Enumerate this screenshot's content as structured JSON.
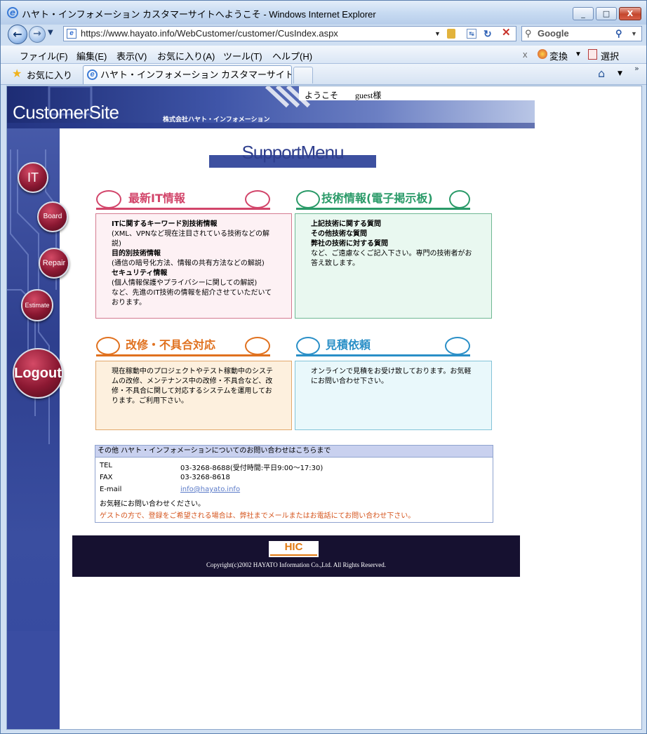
{
  "window": {
    "title": "ハヤト・インフォメーション カスタマーサイトへようこそ - Windows Internet Explorer",
    "minimize": "_",
    "maximize": "□",
    "close": "X"
  },
  "navigation": {
    "url": "https://www.hayato.info/WebCustomer/customer/CusIndex.aspx",
    "search_placeholder": "Google"
  },
  "menubar": {
    "items": [
      "ファイル(F)",
      "編集(E)",
      "表示(V)",
      "お気に入り(A)",
      "ツール(T)",
      "ヘルプ(H)"
    ],
    "close": "x",
    "convert": "変換",
    "select": "選択"
  },
  "favorites": {
    "label": "お気に入り",
    "active_tab": "ハヤト・インフォメーション カスタマーサイト..."
  },
  "header": {
    "logo": "CustomerSite",
    "company": "株式会社ハヤト・インフォメーション",
    "welcome": "ようこそ　　guest様"
  },
  "sidebar": {
    "items": [
      "IT",
      "Board",
      "Repair",
      "Estimate",
      "Logout"
    ]
  },
  "main": {
    "title": "SupportMenu",
    "sections": {
      "it": {
        "heading": "最新IT情報",
        "lines": [
          "ITに関するキーワード別技術情報",
          "(XML、VPNなど現在注目されている技術などの解説)",
          "目的別技術情報",
          "(通信の暗号化方法、情報の共有方法などの解説)",
          "セキュリティ情報",
          "(個人情報保護やプライバシーに関しての解説)",
          "など、先進のIT技術の情報を紹介させていただいております。"
        ]
      },
      "board": {
        "heading": "技術情報(電子掲示板)",
        "lines": [
          "上記技術に関する質問",
          "その他技術な質問",
          "弊社の技術に対する質問",
          "など、ご遠慮なくご記入下さい。専門の技術者がお答え致します。"
        ]
      },
      "repair": {
        "heading": "改修・不具合対応",
        "text": "現在稼動中のプロジェクトやテスト稼動中のシステムの改修、メンテナンス中の改修・不具合など、改修・不具合に関して対応するシステムを運用しております。ご利用下さい。"
      },
      "estimate": {
        "heading": "見積依頼",
        "text": "オンラインで見積をお受け致しております。お気軽にお問い合わせ下さい。"
      }
    },
    "contact": {
      "title": "その他 ハヤト・インフォメーションについてのお問い合わせはこちらまで",
      "tel_label": "TEL",
      "tel": "03-3268-8688(受付時間:平日9:00～17:30)",
      "fax_label": "FAX",
      "fax": "03-3268-8618",
      "email_label": "E-mail",
      "email": "info@hayato.info",
      "note": "お気軽にお問い合わせください。",
      "guest_note": "ゲストの方で、登録をご希望される場合は、弊社までメールまたはお電話にてお問い合わせ下さい。"
    }
  },
  "footer": {
    "logo": "HIC",
    "copyright": "Copyright(c)2002 HAYATO Information Co.,Ltd. All Rights Reserved."
  },
  "colors": {
    "it": "#d2456a",
    "board": "#2a9a68",
    "repair": "#e0711f",
    "estimate": "#2a8fc7",
    "navy": "#2f3f8e"
  }
}
